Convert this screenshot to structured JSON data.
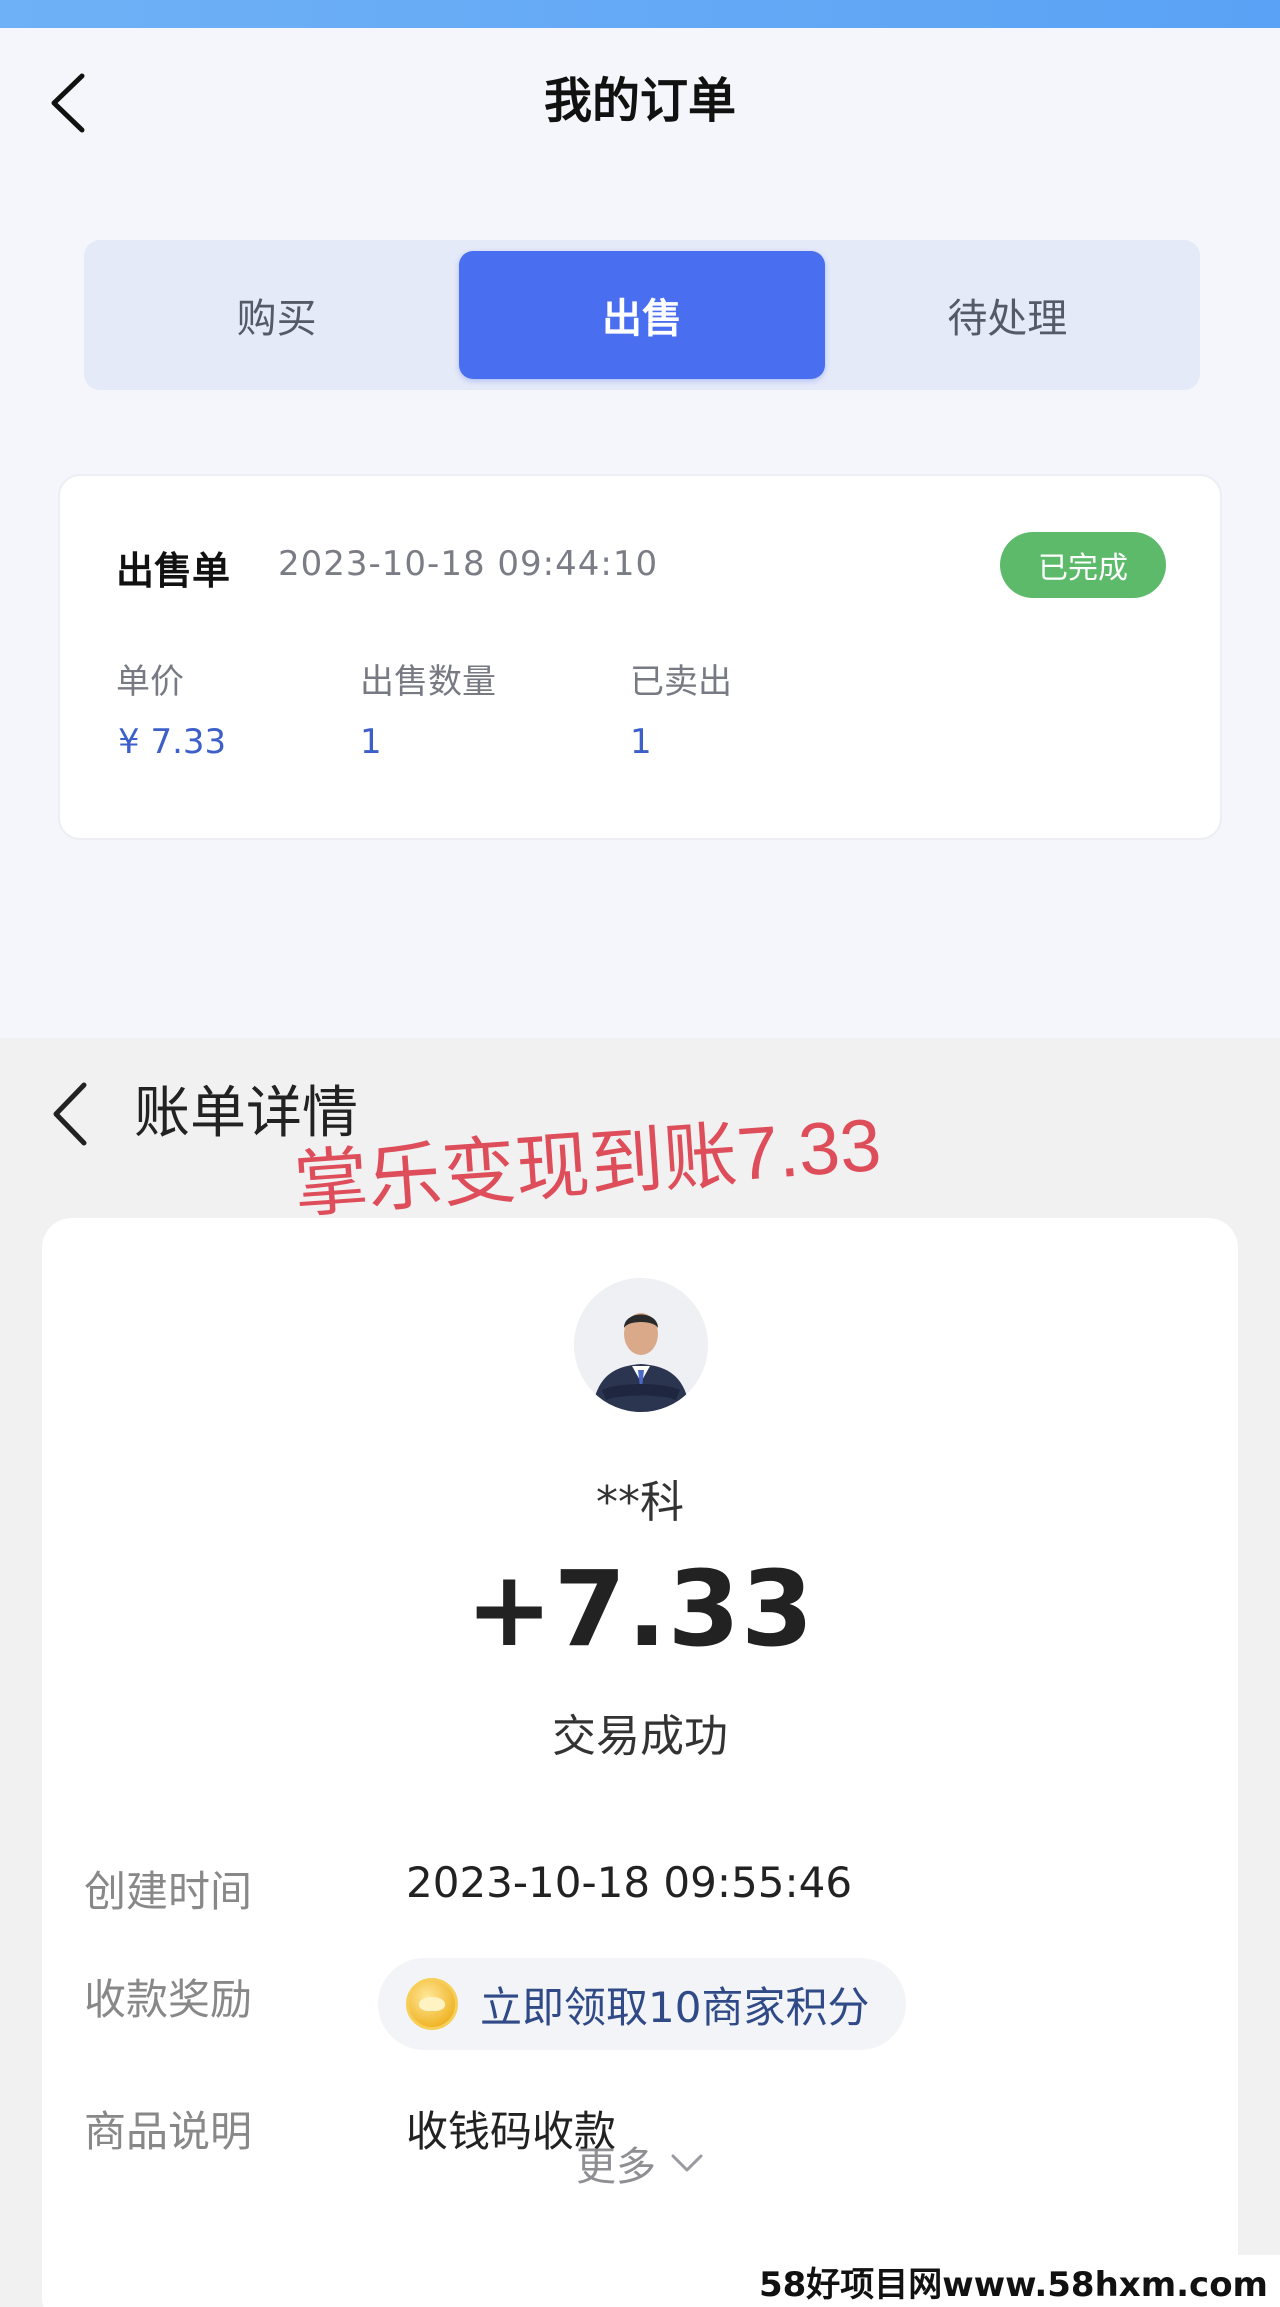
{
  "order_page": {
    "title": "我的订单",
    "tabs": [
      {
        "label": "购买",
        "active": false
      },
      {
        "label": "出售",
        "active": true
      },
      {
        "label": "待处理",
        "active": false
      }
    ],
    "order": {
      "type": "出售单",
      "time": "2023-10-18 09:44:10",
      "status": "已完成",
      "columns": [
        {
          "label": "单价",
          "value": "¥ 7.33"
        },
        {
          "label": "出售数量",
          "value": "1"
        },
        {
          "label": "已卖出",
          "value": "1"
        }
      ]
    }
  },
  "bill_page": {
    "title": "账单详情",
    "overlay_caption": "掌乐变现到账7.33",
    "payer_name": "**科",
    "amount": "+7.33",
    "trade_status": "交易成功",
    "rows": [
      {
        "label": "创建时间",
        "value": "2023-10-18 09:55:46"
      },
      {
        "label": "收款奖励",
        "value": "立即领取10商家积分"
      },
      {
        "label": "商品说明",
        "value": "收钱码收款"
      }
    ],
    "more_label": "更多"
  },
  "watermark": "58好项目网www.58hxm.com",
  "colors": {
    "active_tab": "#4a6ef0",
    "status_badge": "#5cba6a",
    "value_blue": "#3d5fc9",
    "overlay_red": "#dd3d4a"
  },
  "icons": [
    "back-arrow-icon",
    "bill-back-arrow-icon",
    "coin-icon",
    "chevron-down-icon"
  ]
}
